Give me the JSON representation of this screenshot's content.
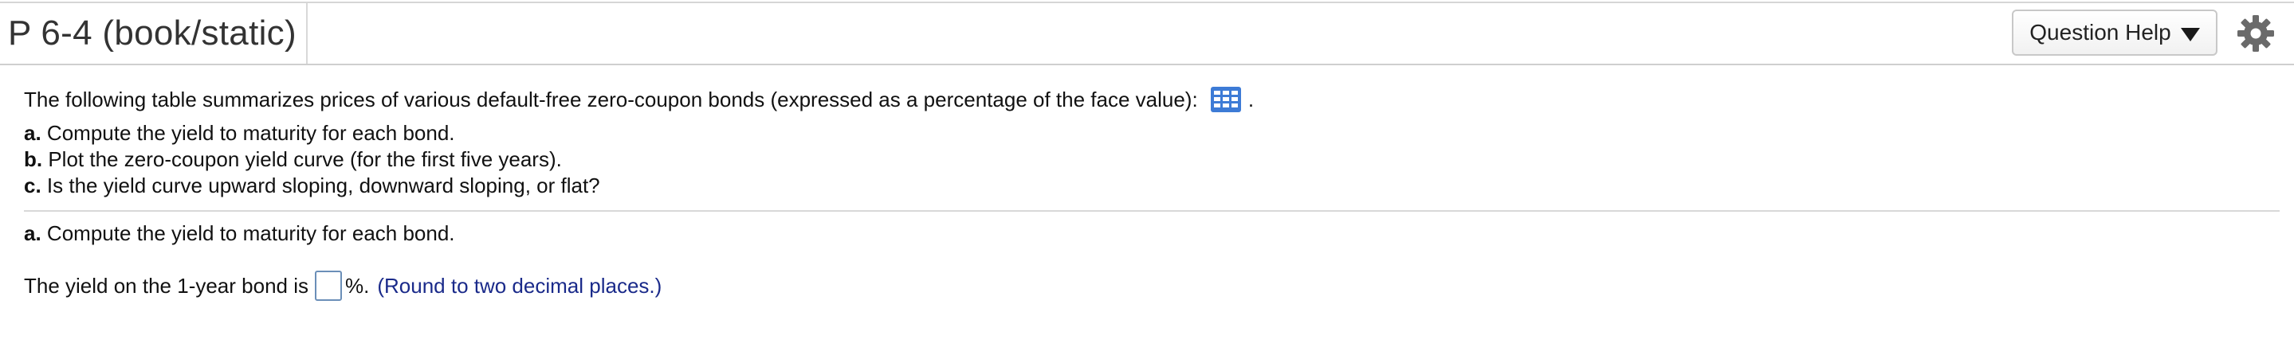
{
  "header": {
    "title": "P 6-4 (book/static)",
    "question_help_label": "Question Help",
    "icons": [
      "chevron-down-icon",
      "gear-icon"
    ]
  },
  "question": {
    "intro": "The following table summarizes prices of various default-free zero-coupon bonds (expressed as a percentage of the face value):",
    "intro_tail": ".",
    "data_table_icon": "table-icon",
    "parts": [
      {
        "letter": "a.",
        "text": "Compute the yield to maturity for each bond."
      },
      {
        "letter": "b.",
        "text": "Plot the zero-coupon yield curve (for the first five years)."
      },
      {
        "letter": "c.",
        "text": "Is the yield curve upward sloping, downward sloping, or flat?"
      }
    ]
  },
  "answer_section": {
    "part_letter": "a.",
    "part_text": "Compute the yield to maturity for each bond.",
    "prompt_before": "The yield on the 1-year bond is",
    "input_value": "",
    "prompt_after": "%.",
    "hint": "(Round to two decimal places.)"
  },
  "colors": {
    "hint": "#1a2a8a",
    "table_icon": "#3d7bd6",
    "input_border": "#6b8fb8"
  }
}
